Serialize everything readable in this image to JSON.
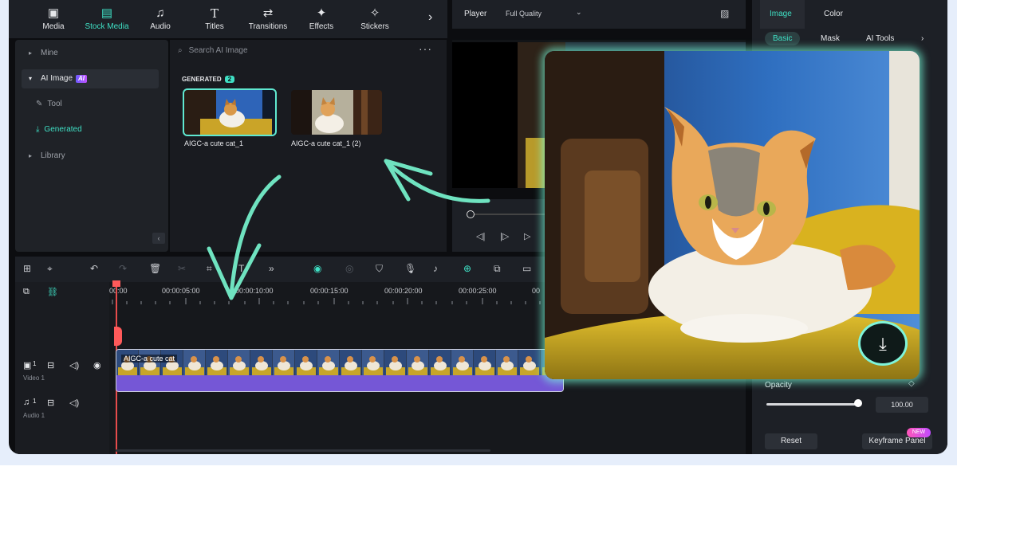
{
  "toolbar": {
    "items": [
      {
        "label": "Media",
        "icon": "media-icon"
      },
      {
        "label": "Stock Media",
        "icon": "stock-media-icon"
      },
      {
        "label": "Audio",
        "icon": "music-note-icon"
      },
      {
        "label": "Titles",
        "icon": "titles-icon"
      },
      {
        "label": "Transitions",
        "icon": "transitions-icon"
      },
      {
        "label": "Effects",
        "icon": "effects-icon"
      },
      {
        "label": "Stickers",
        "icon": "stickers-icon"
      }
    ],
    "active": "Stock Media"
  },
  "left_nav": {
    "mine": "Mine",
    "ai_image": "AI Image",
    "ai_badge": "AI",
    "tool": "Tool",
    "generated": "Generated",
    "library": "Library"
  },
  "media": {
    "search_placeholder": "Search AI Image",
    "section_label": "GENERATED",
    "section_count": "2",
    "thumbs": [
      {
        "caption": "AIGC-a cute cat_1"
      },
      {
        "caption": "AIGC-a cute cat_1 (2)"
      }
    ]
  },
  "player": {
    "label": "Player",
    "quality": "Full Quality"
  },
  "timeline": {
    "ruler": [
      "00:00",
      "00:00:05:00",
      "00:00:10:00",
      "00:00:15:00",
      "00:00:20:00",
      "00:00:25:00",
      "00"
    ],
    "clip_title": "AIGC-a cute cat",
    "video_track": "Video 1",
    "audio_track": "Audio 1",
    "track_num_video": "1",
    "track_num_audio": "1"
  },
  "right_panel": {
    "tabs": [
      "Image",
      "Color"
    ],
    "subtabs": [
      "Basic",
      "Mask",
      "AI Tools"
    ],
    "opacity_label": "Opacity",
    "opacity_value": "100.00",
    "opacity_level": 1.0,
    "reset": "Reset",
    "keyframe": "Keyframe Panel",
    "new_badge": "NEW"
  },
  "colors": {
    "accent": "#3fe0c5",
    "panel": "#1d2026",
    "glow": "#7ff4d9",
    "clip": "#7b5fe0"
  }
}
